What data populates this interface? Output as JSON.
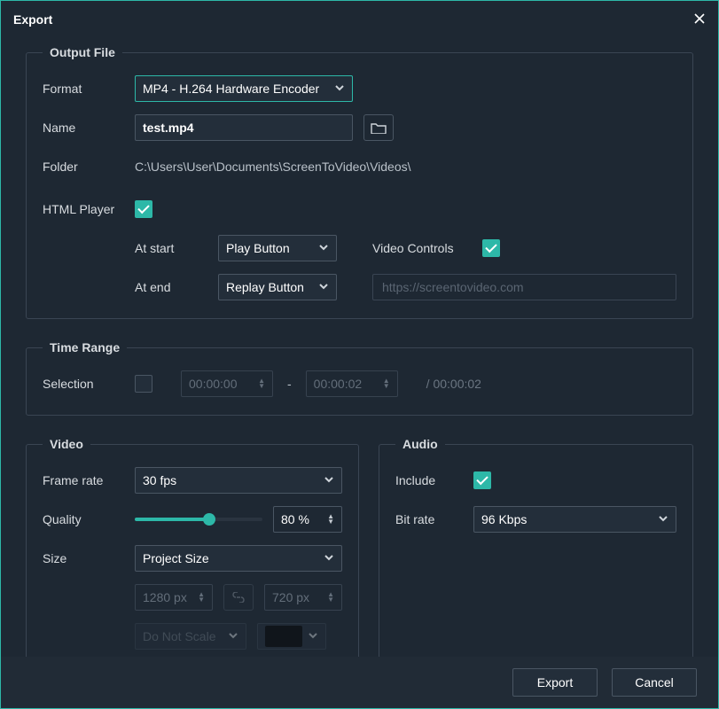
{
  "title": "Export",
  "output": {
    "legend": "Output File",
    "format_label": "Format",
    "format_value": "MP4 - H.264 Hardware Encoder",
    "name_label": "Name",
    "name_value": "test.mp4",
    "folder_label": "Folder",
    "folder_value": "C:\\Users\\User\\Documents\\ScreenToVideo\\Videos\\",
    "html_player_label": "HTML Player",
    "html_player_checked": true,
    "at_start_label": "At start",
    "at_start_value": "Play Button",
    "at_end_label": "At end",
    "at_end_value": "Replay Button",
    "video_controls_label": "Video Controls",
    "video_controls_checked": true,
    "url_placeholder": "https://screentovideo.com"
  },
  "timerange": {
    "legend": "Time Range",
    "selection_label": "Selection",
    "selection_checked": false,
    "from": "00:00:00",
    "to": "00:00:02",
    "sep": "-",
    "duration": "/ 00:00:02"
  },
  "video": {
    "legend": "Video",
    "framerate_label": "Frame rate",
    "framerate_value": "30 fps",
    "quality_label": "Quality",
    "quality_value": "80 %",
    "quality_pct": 58,
    "size_label": "Size",
    "size_value": "Project Size",
    "width_value": "1280 px",
    "height_value": "720 px",
    "scale_value": "Do Not Scale"
  },
  "audio": {
    "legend": "Audio",
    "include_label": "Include",
    "include_checked": true,
    "bitrate_label": "Bit rate",
    "bitrate_value": "96 Kbps"
  },
  "footer": {
    "export": "Export",
    "cancel": "Cancel"
  }
}
